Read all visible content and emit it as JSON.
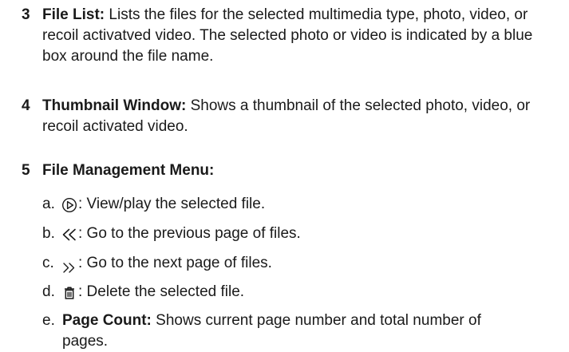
{
  "items": [
    {
      "number": "3",
      "term": "File List:",
      "text": "Lists the files for the selected multimedia type, photo, video, or recoil activatved video. The selected photo or video is indicated by a blue box around the file name."
    },
    {
      "number": "4",
      "term": "Thumbnail Window:",
      "text": "Shows a thumbnail of the selected photo, video, or recoil activated video."
    },
    {
      "number": "5",
      "term": "File Management Menu:",
      "text": ""
    }
  ],
  "menu": [
    {
      "letter": "a.",
      "icon": "play-circle-icon",
      "text": ": View/play the selected file."
    },
    {
      "letter": "b.",
      "icon": "double-chevron-left-icon",
      "text": ": Go to the previous page of files."
    },
    {
      "letter": "c.",
      "icon": "double-chevron-right-icon",
      "text": ": Go to the next page of files."
    },
    {
      "letter": "d.",
      "icon": "trash-icon",
      "text": ": Delete the selected file."
    },
    {
      "letter": "e.",
      "term": "Page Count:",
      "text": "Shows current page number and total number of pages."
    }
  ]
}
